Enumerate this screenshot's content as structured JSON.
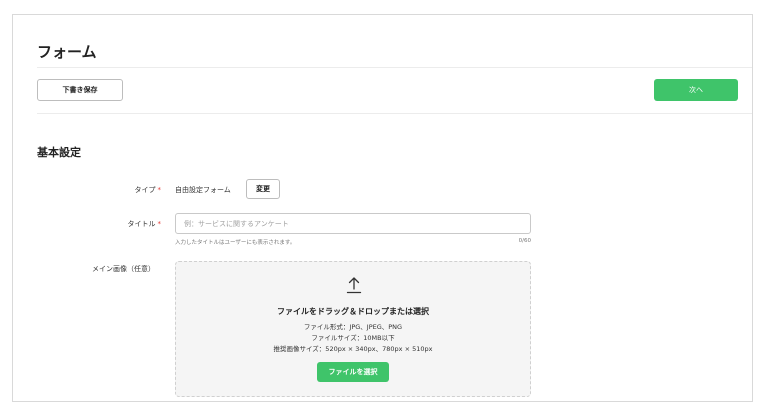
{
  "header": {
    "title": "フォーム",
    "draft_button": "下書き保存",
    "next_button": "次へ"
  },
  "section": {
    "title": "基本設定"
  },
  "fields": {
    "type": {
      "label": "タイプ",
      "required_mark": "*",
      "value": "自由設定フォーム",
      "change_button": "変更"
    },
    "title": {
      "label": "タイトル",
      "required_mark": "*",
      "placeholder": "例：サービスに関するアンケート",
      "value": "",
      "hint": "入力したタイトルはユーザーにも表示されます。",
      "counter": "0/60"
    },
    "main_image": {
      "label": "メイン画像（任意）",
      "icon": "upload-icon",
      "dropzone_title": "ファイルをドラッグ＆ドロップまたは選択",
      "formats": "ファイル形式：JPG、JPEG、PNG",
      "size_limit": "ファイルサイズ：10MB以下",
      "recommended": "推奨画像サイズ：520px × 340px、780px × 510px",
      "select_button": "ファイルを選択"
    }
  },
  "colors": {
    "accent": "#3fc46a",
    "required": "#e53935",
    "border": "#d9d9d9"
  }
}
